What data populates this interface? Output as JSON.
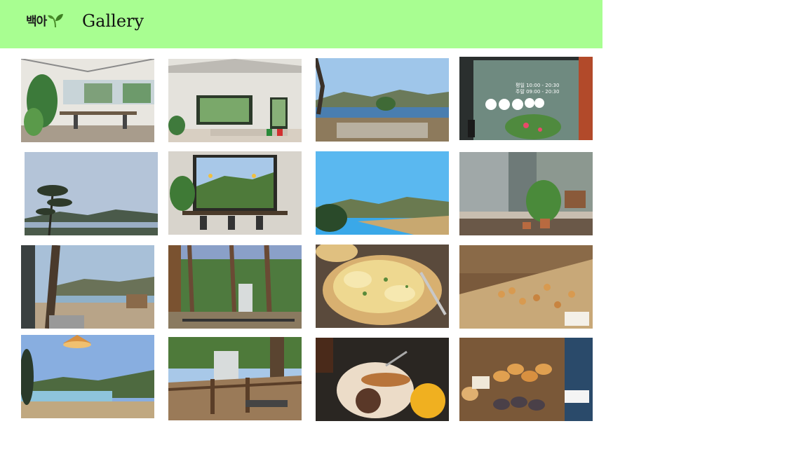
{
  "header": {
    "logo_text": "백아",
    "title": "Gallery",
    "accent_color": "#a8fe91"
  },
  "gallery": {
    "photos": [
      {
        "id": "p1",
        "scene": "cafe interior with plants"
      },
      {
        "id": "p2",
        "scene": "cafe lounge with window view"
      },
      {
        "id": "p3",
        "scene": "lake and hills with stone bench"
      },
      {
        "id": "p4",
        "scene": "glass door with opening hours sign"
      },
      {
        "id": "p5",
        "scene": "pine tree silhouette over lake"
      },
      {
        "id": "p6",
        "scene": "window seat facing green hills"
      },
      {
        "id": "p7",
        "scene": "blue lake and hills"
      },
      {
        "id": "p8",
        "scene": "terrace with potted plants"
      },
      {
        "id": "p9",
        "scene": "outdoor path with pines and lake"
      },
      {
        "id": "p10",
        "scene": "forest path with building"
      },
      {
        "id": "p11",
        "scene": "garlic bread close-up"
      },
      {
        "id": "p12",
        "scene": "bakery display of pastries"
      },
      {
        "id": "p13",
        "scene": "lake view with hanging lamp"
      },
      {
        "id": "p14",
        "scene": "wooden deck with building"
      },
      {
        "id": "p15",
        "scene": "bread plate with juice"
      },
      {
        "id": "p16",
        "scene": "croissants on bakery rack"
      }
    ]
  },
  "door_sign": {
    "weekday": "평일 10:00 - 20:30",
    "weekend": "주말 09:00 - 20:30"
  }
}
